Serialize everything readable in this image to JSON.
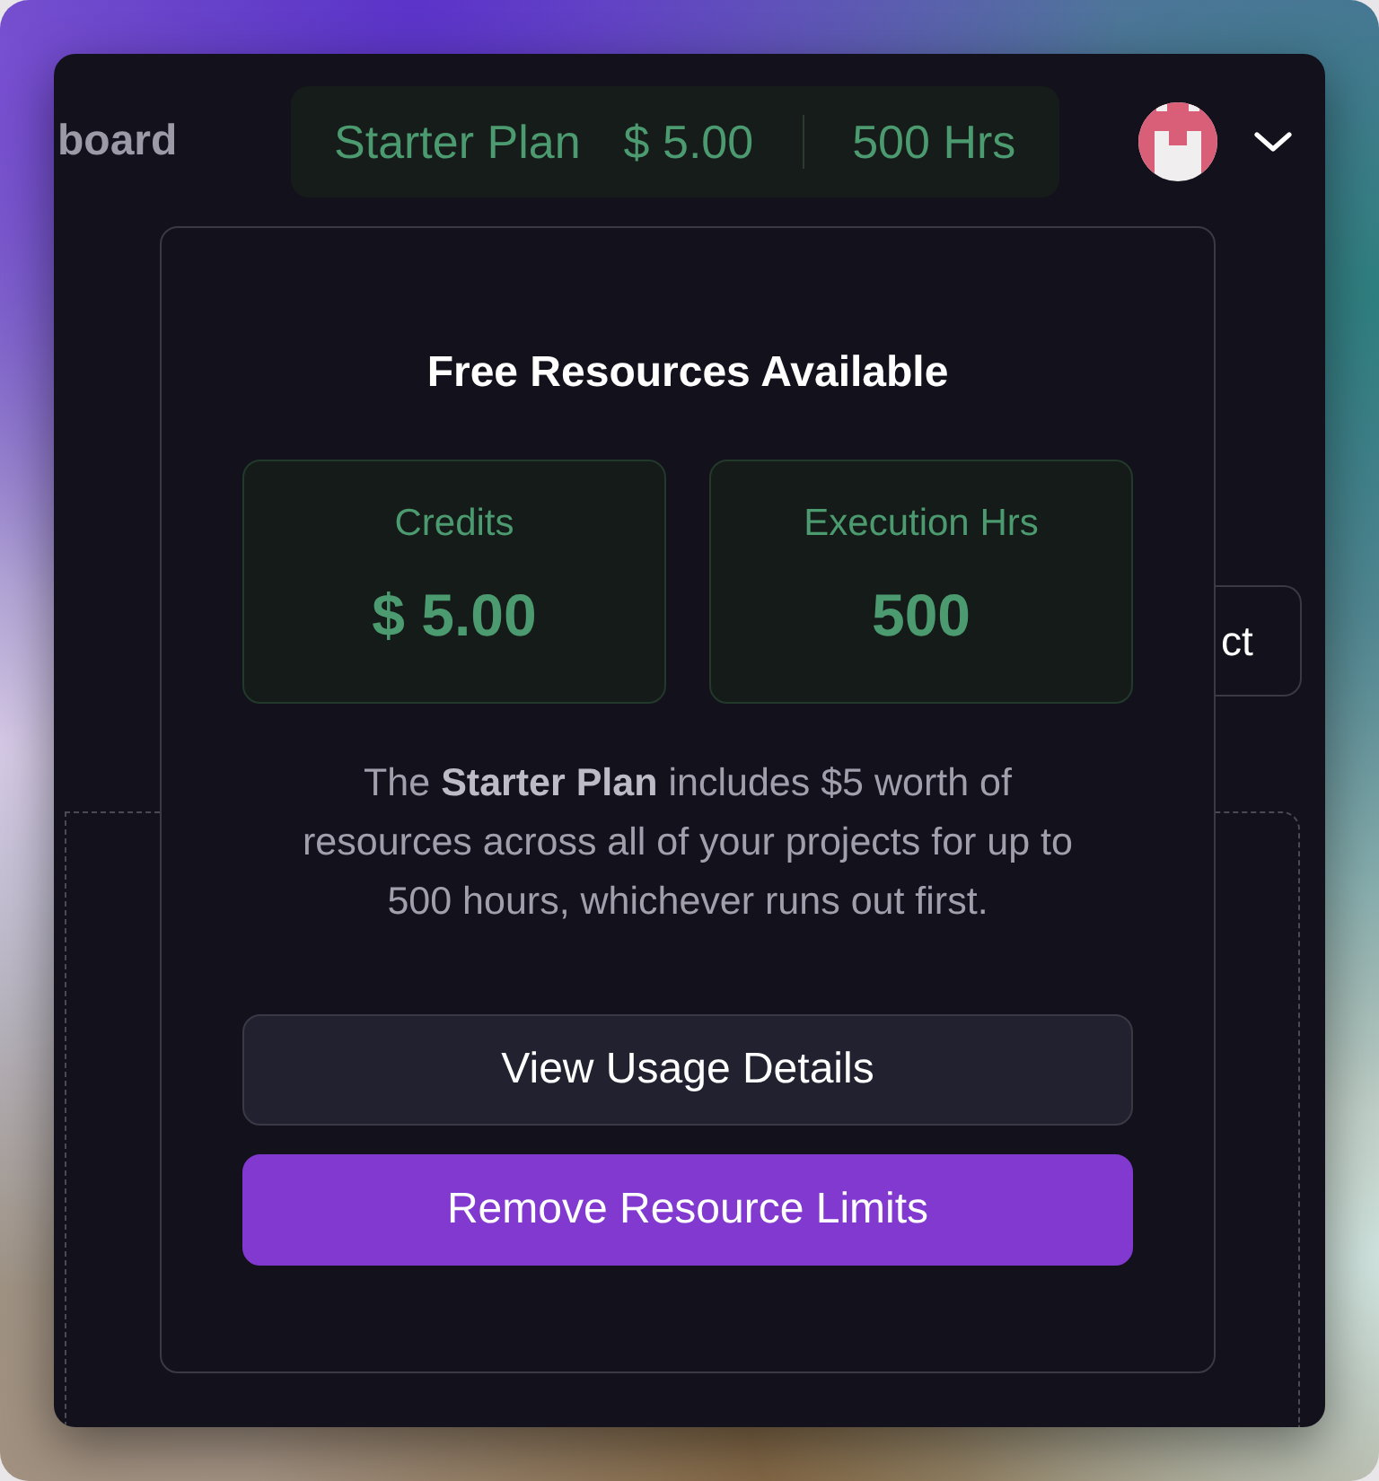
{
  "header": {
    "page_title": "board",
    "plan": {
      "name": "Starter Plan",
      "credits": "$ 5.00",
      "hours": "500 Hrs"
    }
  },
  "background": {
    "button_label": "ct"
  },
  "popup": {
    "title": "Free Resources Available",
    "cards": [
      {
        "label": "Credits",
        "value": "$ 5.00"
      },
      {
        "label": "Execution Hrs",
        "value": "500"
      }
    ],
    "description": "The **Starter Plan** includes $5 worth of resources across all of your projects for up to 500 hours, whichever runs out first.",
    "buttons": [
      {
        "label": "View Usage Details",
        "kind": "secondary"
      },
      {
        "label": "Remove Resource Limits",
        "kind": "primary"
      }
    ]
  }
}
